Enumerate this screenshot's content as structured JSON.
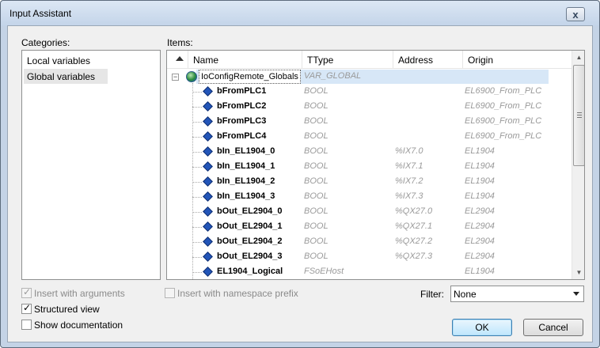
{
  "window": {
    "title": "Input Assistant",
    "close_label": "x"
  },
  "categories": {
    "label": "Categories:",
    "items": [
      {
        "label": "Local variables"
      },
      {
        "label": "Global variables"
      }
    ]
  },
  "items": {
    "label": "Items:",
    "columns": {
      "name": "Name",
      "type": "Type",
      "type_marker": "T",
      "address": "Address",
      "origin": "Origin"
    },
    "root": {
      "name": "IoConfigRemote_Globals",
      "type": "VAR_GLOBAL",
      "toggle": "−"
    },
    "rows": [
      {
        "name": "bFromPLC1",
        "type": "BOOL",
        "address": "",
        "origin": "EL6900_From_PLC"
      },
      {
        "name": "bFromPLC2",
        "type": "BOOL",
        "address": "",
        "origin": "EL6900_From_PLC"
      },
      {
        "name": "bFromPLC3",
        "type": "BOOL",
        "address": "",
        "origin": "EL6900_From_PLC"
      },
      {
        "name": "bFromPLC4",
        "type": "BOOL",
        "address": "",
        "origin": "EL6900_From_PLC"
      },
      {
        "name": "bIn_EL1904_0",
        "type": "BOOL",
        "address": "%IX7.0",
        "origin": "EL1904"
      },
      {
        "name": "bIn_EL1904_1",
        "type": "BOOL",
        "address": "%IX7.1",
        "origin": "EL1904"
      },
      {
        "name": "bIn_EL1904_2",
        "type": "BOOL",
        "address": "%IX7.2",
        "origin": "EL1904"
      },
      {
        "name": "bIn_EL1904_3",
        "type": "BOOL",
        "address": "%IX7.3",
        "origin": "EL1904"
      },
      {
        "name": "bOut_EL2904_0",
        "type": "BOOL",
        "address": "%QX27.0",
        "origin": "EL2904"
      },
      {
        "name": "bOut_EL2904_1",
        "type": "BOOL",
        "address": "%QX27.1",
        "origin": "EL2904"
      },
      {
        "name": "bOut_EL2904_2",
        "type": "BOOL",
        "address": "%QX27.2",
        "origin": "EL2904"
      },
      {
        "name": "bOut_EL2904_3",
        "type": "BOOL",
        "address": "%QX27.3",
        "origin": "EL2904"
      },
      {
        "name": "EL1904_Logical",
        "type": "FSoEHost",
        "address": "",
        "origin": "EL1904"
      }
    ]
  },
  "options": {
    "insert_with_arguments": {
      "label": "Insert with arguments",
      "checked": true,
      "disabled": true
    },
    "structured_view": {
      "label": "Structured view",
      "checked": true,
      "disabled": false
    },
    "show_documentation": {
      "label": "Show documentation",
      "checked": false,
      "disabled": false
    },
    "insert_with_namespace_prefix": {
      "label": "Insert with namespace prefix",
      "checked": false,
      "disabled": true
    }
  },
  "filter": {
    "label": "Filter:",
    "value": "None"
  },
  "buttons": {
    "ok": "OK",
    "cancel": "Cancel"
  },
  "check_glyph": "✓"
}
